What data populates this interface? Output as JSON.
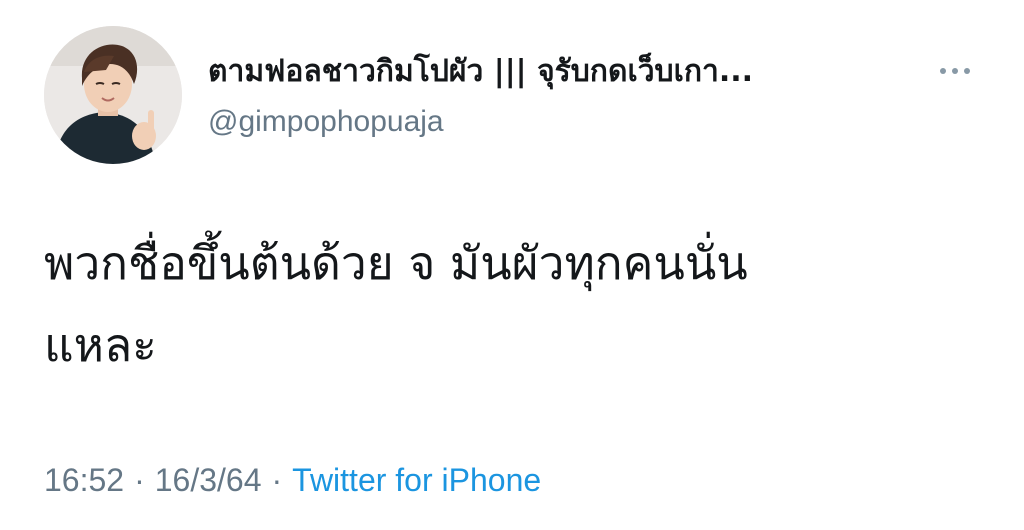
{
  "tweet": {
    "author": {
      "display_name": "ตามฟอลชาวกิมโปผัว ||| จุรับกดเว็บเกา...",
      "handle": "@gimpophopuaja"
    },
    "more_icon": "more-horizontal-icon",
    "text_line_1": "พวกชื่อขึ้นต้นด้วย จ มันผัวทุกคนนั่น",
    "text_line_2": "แหละ",
    "time": "16:52",
    "separator": "·",
    "date": "16/3/64",
    "source": "Twitter for iPhone"
  },
  "colors": {
    "text_primary": "#14171a",
    "text_secondary": "#657786",
    "link": "#1b95e0",
    "background": "#ffffff"
  }
}
